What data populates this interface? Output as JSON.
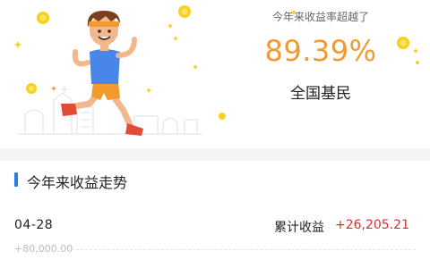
{
  "hero": {
    "caption": "今年来收益率超越了",
    "percent": "89.39%",
    "rank_label": "全国基民",
    "accent_color": "#f29a2e"
  },
  "trend": {
    "section_title": "今年来收益走势",
    "accent_color": "#2b7de0",
    "date": "04-28",
    "cumulative_label": "累计收益",
    "cumulative_value": "+26,205.21",
    "value_color": "#d8312f",
    "axis_top_label": "+80,000.00"
  },
  "icons": {
    "runner": "runner-illustration",
    "coin": "coin-icon"
  }
}
